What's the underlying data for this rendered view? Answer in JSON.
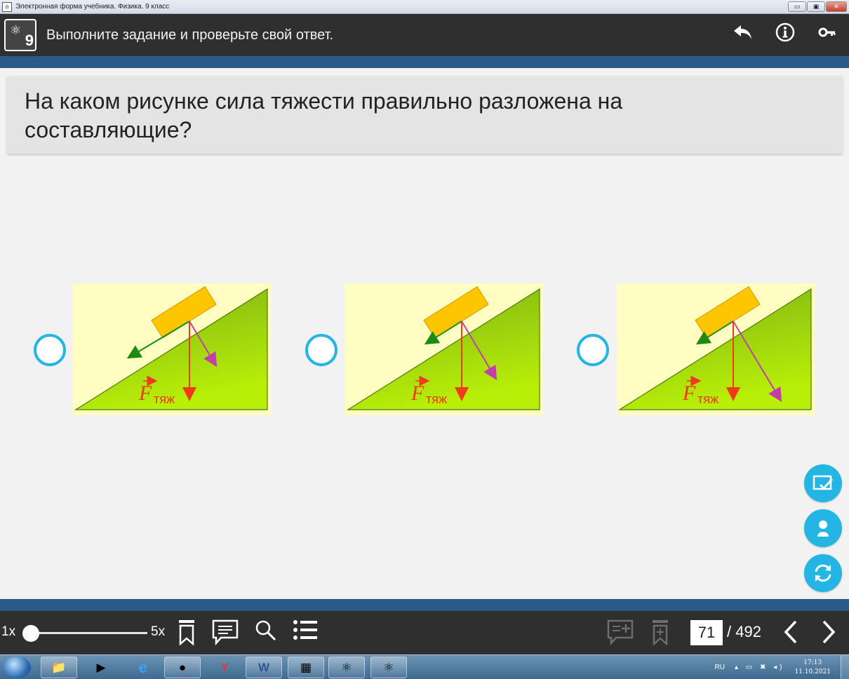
{
  "window": {
    "title": "Электронная форма учебника. Физика. 9 класс",
    "buttons": {
      "minimize": "▭",
      "maximize": "▣",
      "close": "✕"
    }
  },
  "header": {
    "logo_number": "9",
    "instruction": "Выполните задание и проверьте свой ответ.",
    "icons": [
      "undo-icon",
      "info-icon",
      "key-icon"
    ]
  },
  "question": {
    "text": "На каком рисунке сила тяжести правильно разложена на составляющие?"
  },
  "options": [
    {
      "label": "F",
      "sub": "тяж",
      "variant": "a"
    },
    {
      "label": "F",
      "sub": "тяж",
      "variant": "b"
    },
    {
      "label": "F",
      "sub": "тяж",
      "variant": "c"
    }
  ],
  "figure_colors": {
    "background": "#fffdc2",
    "incline_top": "#7db214",
    "incline_bottom": "#b8ee08",
    "block": "#fdc600",
    "gravity_arrow": "#f03a1a",
    "parallel_arrow": "#1e8a14",
    "normal_arrow": "#c53ea8"
  },
  "side_buttons": [
    "check-answer-icon",
    "show-answer-icon",
    "refresh-icon"
  ],
  "toolbar": {
    "zoom_min": "1x",
    "zoom_max": "5x",
    "zoom_level": 0,
    "current_page": "71",
    "total_pages": "/ 492"
  },
  "taskbar": {
    "lang": "RU",
    "time": "17:13",
    "date": "11.10.2021"
  },
  "accent_color": "#25b5e5"
}
